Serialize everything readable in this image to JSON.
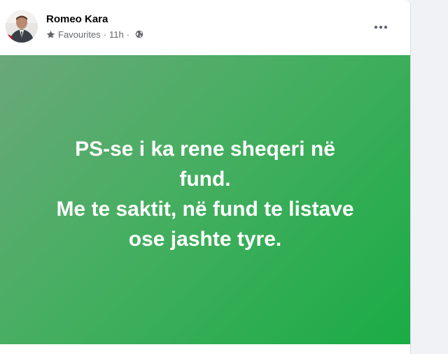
{
  "post": {
    "author": "Romeo Kara",
    "audience_label": "Favourites",
    "separator": "·",
    "timestamp": "11h",
    "privacy_icon": "globe-icon",
    "audience_icon": "star-icon",
    "more_icon": "more-options-icon",
    "text": "PS-se i ka rene sheqeri në\nfund.\nMe te saktit, në fund te listave\nose jashte tyre.",
    "background_gradient": [
      "#6aa87a",
      "#49ae63",
      "#1aac45"
    ]
  }
}
